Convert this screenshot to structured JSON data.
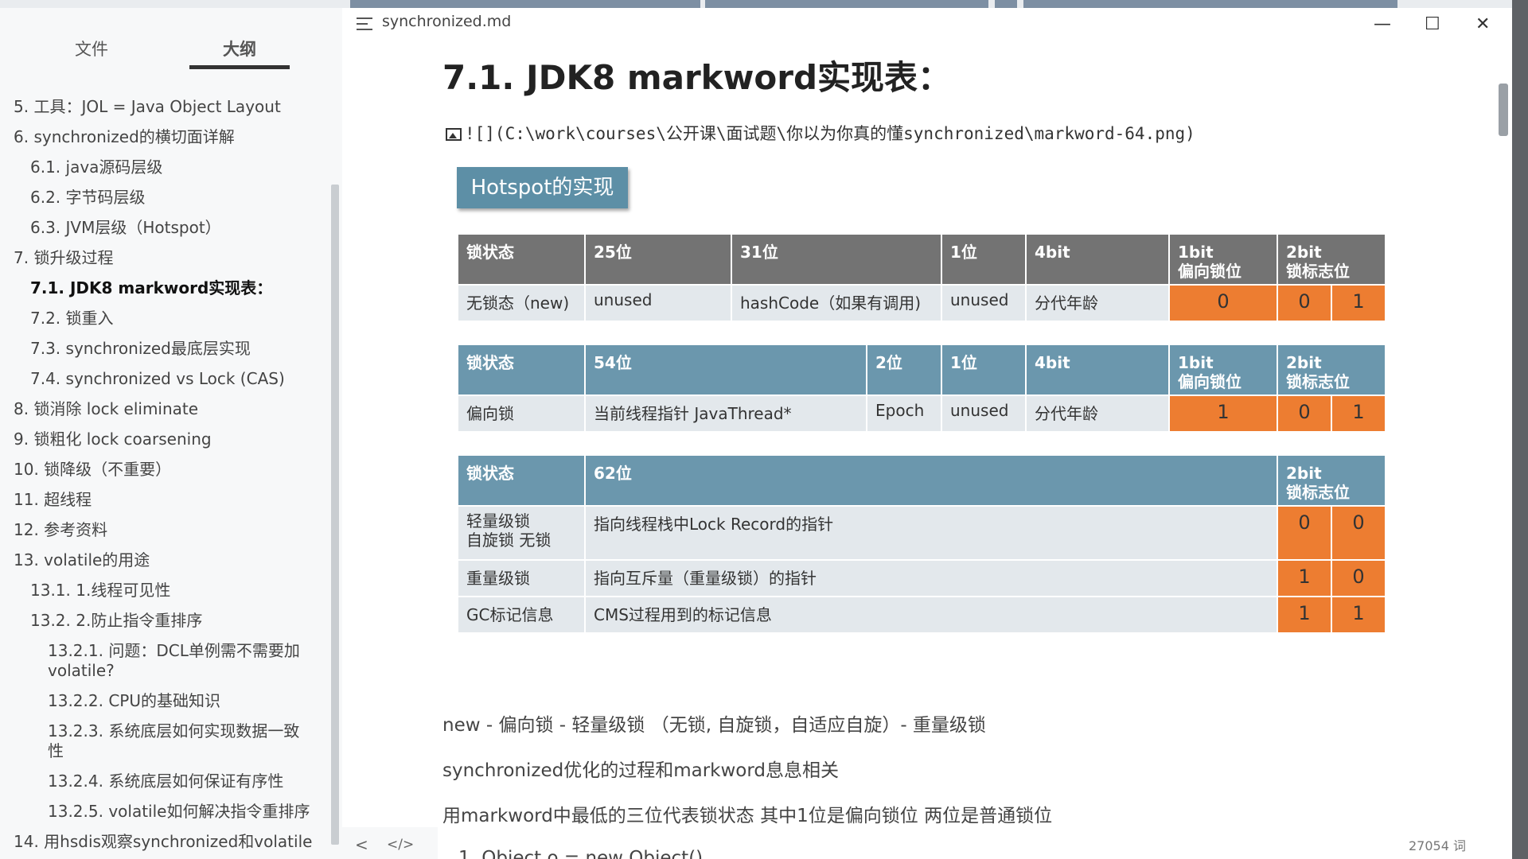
{
  "window": {
    "filename": "synchronized.md",
    "minimize_glyph": "—",
    "maximize_glyph": "☐",
    "close_glyph": "✕"
  },
  "sidebar": {
    "tabs": [
      "文件",
      "大纲"
    ],
    "outline": [
      {
        "level": 1,
        "label": "5. 工具：JOL = Java Object Layout"
      },
      {
        "level": 1,
        "label": "6. synchronized的横切面详解"
      },
      {
        "level": 2,
        "label": "6.1. java源码层级"
      },
      {
        "level": 2,
        "label": "6.2. 字节码层级"
      },
      {
        "level": 2,
        "label": "6.3. JVM层级（Hotspot）"
      },
      {
        "level": 1,
        "label": "7. 锁升级过程"
      },
      {
        "level": 2,
        "label": "7.1. JDK8 markword实现表：",
        "active": true
      },
      {
        "level": 2,
        "label": "7.2. 锁重入"
      },
      {
        "level": 2,
        "label": "7.3. synchronized最底层实现"
      },
      {
        "level": 2,
        "label": "7.4. synchronized vs Lock (CAS)"
      },
      {
        "level": 1,
        "label": "8. 锁消除 lock eliminate"
      },
      {
        "level": 1,
        "label": "9. 锁粗化 lock coarsening"
      },
      {
        "level": 1,
        "label": "10. 锁降级（不重要）"
      },
      {
        "level": 1,
        "label": "11. 超线程"
      },
      {
        "level": 1,
        "label": "12. 参考资料"
      },
      {
        "level": 1,
        "label": "13. volatile的用途"
      },
      {
        "level": 2,
        "label": "13.1. 1.线程可见性"
      },
      {
        "level": 2,
        "label": "13.2. 2.防止指令重排序"
      },
      {
        "level": 3,
        "label": "13.2.1. 问题：DCL单例需不需要加",
        "cont": "volatile?"
      },
      {
        "level": 3,
        "label": "13.2.2. CPU的基础知识"
      },
      {
        "level": 3,
        "label": "13.2.3. 系统底层如何实现数据一致",
        "cont": "性"
      },
      {
        "level": 3,
        "label": "13.2.4. 系统底层如何保证有序性"
      },
      {
        "level": 3,
        "label": "13.2.5. volatile如何解决指令重排序"
      },
      {
        "level": 1,
        "label": "14. 用hsdis观察synchronized和volatile"
      }
    ]
  },
  "editor": {
    "heading": "7.1. JDK8 markword实现表：",
    "image_markdown": "![](C:\\work\\courses\\公开课\\面试题\\你以为你真的懂synchronized\\markword-64.png)",
    "image": {
      "label": "Hotspot的实现",
      "table1": {
        "header": [
          "锁状态",
          "25位",
          "31位",
          "1位",
          "4bit",
          "1bit\n偏向锁位",
          "2bit\n锁标志位"
        ],
        "row": [
          "无锁态（new)",
          "unused",
          "hashCode（如果有调用)",
          "unused",
          "分代年龄",
          "0",
          "0",
          "1"
        ]
      },
      "table2": {
        "header": [
          "锁状态",
          "54位",
          "2位",
          "1位",
          "4bit",
          "1bit\n偏向锁位",
          "2bit\n锁标志位"
        ],
        "row": [
          "偏向锁",
          "当前线程指针 JavaThread*",
          "Epoch",
          "unused",
          "分代年龄",
          "1",
          "0",
          "1"
        ]
      },
      "table3": {
        "header": [
          "锁状态",
          "62位",
          "2bit\n锁标志位"
        ],
        "rows": [
          [
            "轻量级锁\n自旋锁 无锁",
            "指向线程栈中Lock Record的指针",
            "0",
            "0"
          ],
          [
            "重量级锁",
            "指向互斥量（重量级锁）的指针",
            "1",
            "0"
          ],
          [
            "GC标记信息",
            "CMS过程用到的标记信息",
            "1",
            "1"
          ]
        ]
      }
    },
    "paragraphs": [
      "new - 偏向锁 - 轻量级锁 （无锁, 自旋锁，自适应自旋）- 重量级锁",
      "synchronized优化的过程和markword息息相关",
      "用markword中最低的三位代表锁状态 其中1位是偏向锁位 两位是普通锁位"
    ],
    "partial_line": "1. Object o = new Object()"
  },
  "statusbar": {
    "prev_glyph": "<",
    "source_glyph": "</>",
    "word_count": "27054 词"
  },
  "colors": {
    "orange": "#ed7d31",
    "header_gray": "#737373",
    "header_blue": "#6b97ad",
    "cell_bg": "#e3e8ec"
  }
}
